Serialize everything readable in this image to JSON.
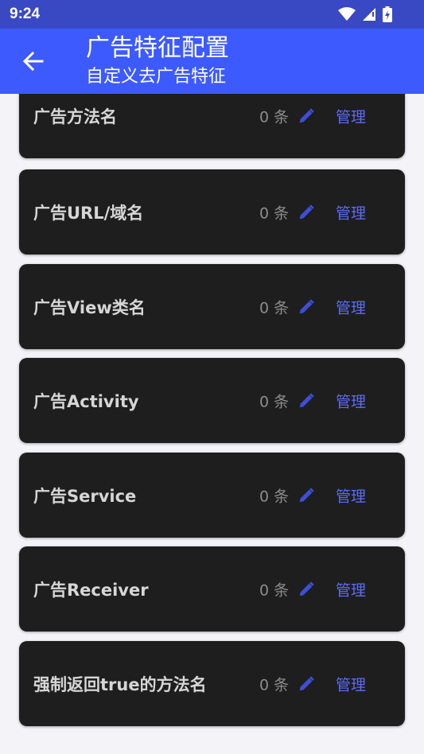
{
  "status_bar": {
    "time": "9:24"
  },
  "app_bar": {
    "title": "广告特征配置",
    "subtitle": "自定义去广告特征"
  },
  "items": [
    {
      "label": "广告方法名",
      "count": "0 条",
      "action": "管理"
    },
    {
      "label": "广告URL/域名",
      "count": "0 条",
      "action": "管理"
    },
    {
      "label": "广告View类名",
      "count": "0 条",
      "action": "管理"
    },
    {
      "label": "广告Activity",
      "count": "0 条",
      "action": "管理"
    },
    {
      "label": "广告Service",
      "count": "0 条",
      "action": "管理"
    },
    {
      "label": "广告Receiver",
      "count": "0 条",
      "action": "管理"
    },
    {
      "label": "强制返回true的方法名",
      "count": "0 条",
      "action": "管理"
    }
  ],
  "colors": {
    "status_bar": "#3949c4",
    "app_bar": "#3d5afe",
    "card_bg": "#1e1e1e",
    "accent": "#5c6bf5"
  }
}
